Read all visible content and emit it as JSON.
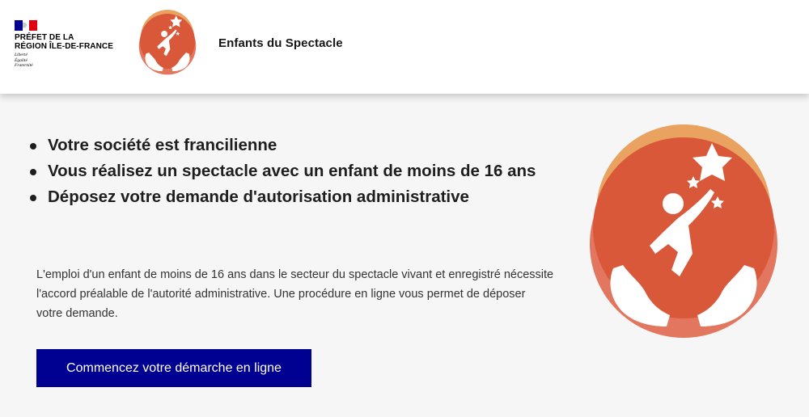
{
  "header": {
    "prefet_line1": "Préfet de la",
    "prefet_line2": "Région Île-de-France",
    "devise": [
      "Liberté",
      "Égalité",
      "Fraternité"
    ],
    "site_title": "Enfants du Spectacle",
    "logo_icon": "child-reaching-star-icon"
  },
  "main": {
    "bullets": [
      "Votre société est francilienne",
      "Vous réalisez un spectacle avec un enfant de moins de 16 ans",
      "Déposez votre demande d'autorisation administrative"
    ],
    "intro": "L'emploi d'un enfant de moins de 16 ans dans le secteur du spectacle vivant et enregistré nécessite l'accord préalable de l'autorité administrative. Une procédure en ligne vous permet de déposer votre demande.",
    "cta_label": "Commencez votre démarche en ligne"
  },
  "colors": {
    "primary_blue": "#000091",
    "flag_blue": "#000091",
    "flag_red": "#e1000f",
    "logo_orange_light": "#e9a25f",
    "logo_orange_dark": "#d9583a",
    "logo_salmon": "#e3765f"
  }
}
